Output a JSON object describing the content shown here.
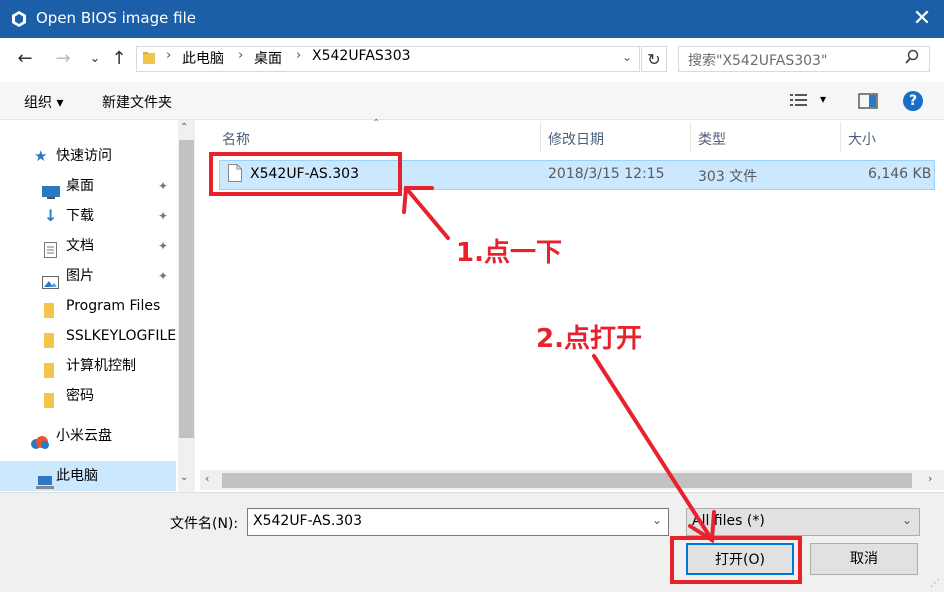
{
  "window": {
    "title": "Open BIOS image file",
    "close_glyph": "✕"
  },
  "nav": {
    "back": "←",
    "forward": "→",
    "history": "⌄",
    "up": "↑",
    "breadcrumb": [
      "此电脑",
      "桌面",
      "X542UFAS303"
    ],
    "separator": "›",
    "refresh": "↻",
    "search_placeholder": "搜索\"X542UFAS303\""
  },
  "toolbar": {
    "organize": "组织 ▾",
    "new_folder": "新建文件夹",
    "view_icon": "▾",
    "help": "?"
  },
  "sidebar": {
    "items": [
      {
        "label": "快速访问",
        "icon": "star-icon",
        "pinned": false
      },
      {
        "label": "桌面",
        "icon": "desktop-icon",
        "pinned": true
      },
      {
        "label": "下载",
        "icon": "download-icon",
        "pinned": true
      },
      {
        "label": "文档",
        "icon": "document-icon",
        "pinned": true
      },
      {
        "label": "图片",
        "icon": "pictures-icon",
        "pinned": true
      },
      {
        "label": "Program Files",
        "icon": "folder-icon",
        "pinned": false
      },
      {
        "label": "SSLKEYLOGFILE",
        "icon": "folder-icon",
        "pinned": false
      },
      {
        "label": "计算机控制",
        "icon": "folder-icon",
        "pinned": false
      },
      {
        "label": "密码",
        "icon": "folder-icon",
        "pinned": false
      },
      {
        "label": "小米云盘",
        "icon": "cloud-icon",
        "pinned": false
      },
      {
        "label": "此电脑",
        "icon": "computer-icon",
        "pinned": false,
        "selected": true
      }
    ],
    "pin_glyph": "📌"
  },
  "file_list": {
    "columns": [
      "名称",
      "修改日期",
      "类型",
      "大小"
    ],
    "files": [
      {
        "name": "X542UF-AS.303",
        "modified": "2018/3/15 12:15",
        "type": "303 文件",
        "size": "6,146 KB",
        "selected": true
      }
    ]
  },
  "footer": {
    "filename_label": "文件名(N):",
    "filename_value": "X542UF-AS.303",
    "filter_value": "All files (*)",
    "open_button": "打开(O)",
    "cancel_button": "取消"
  },
  "annotations": {
    "step1": "1.点一下",
    "step2": "2.点打开"
  },
  "colors": {
    "titlebar": "#1b5fa8",
    "selection": "#cce8ff",
    "annotation": "#e8222c"
  }
}
